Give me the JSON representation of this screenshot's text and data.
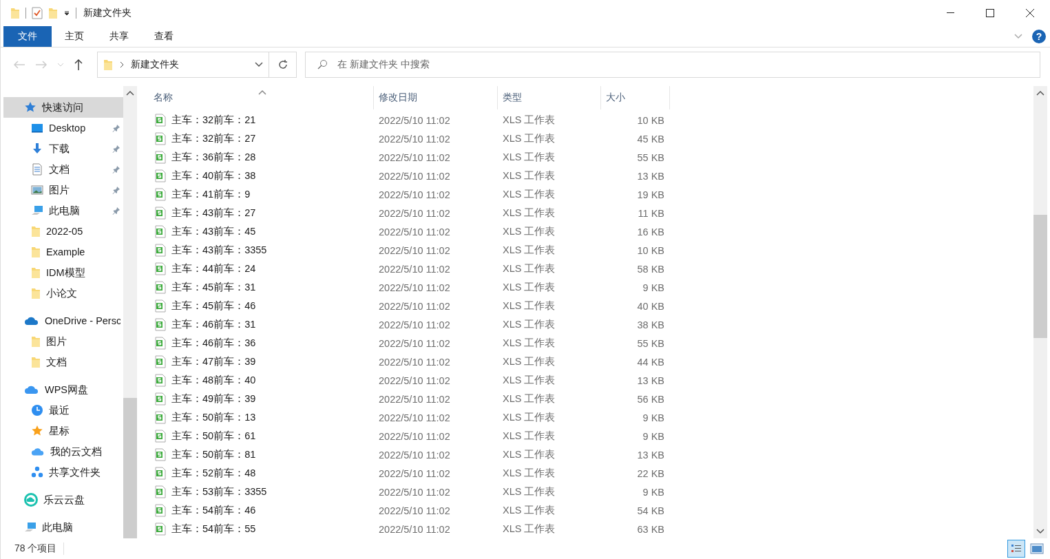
{
  "window": {
    "title": "新建文件夹"
  },
  "ribbon_tabs": [
    {
      "label": "文件",
      "selected": true
    },
    {
      "label": "主页",
      "selected": false
    },
    {
      "label": "共享",
      "selected": false
    },
    {
      "label": "查看",
      "selected": false
    }
  ],
  "help": "?",
  "address": {
    "path": "新建文件夹"
  },
  "search": {
    "placeholder": "在 新建文件夹 中搜索"
  },
  "sidebar": [
    {
      "label": "快速访问",
      "kind": "quick",
      "selected": true,
      "children": [
        {
          "label": "Desktop",
          "kind": "desktop",
          "pinned": true
        },
        {
          "label": "下载",
          "kind": "download",
          "pinned": true
        },
        {
          "label": "文档",
          "kind": "document",
          "pinned": true
        },
        {
          "label": "图片",
          "kind": "pictures",
          "pinned": true
        },
        {
          "label": "此电脑",
          "kind": "pc",
          "pinned": true
        },
        {
          "label": "2022-05",
          "kind": "folder",
          "pinned": false
        },
        {
          "label": "Example",
          "kind": "folder",
          "pinned": false
        },
        {
          "label": "IDM模型",
          "kind": "folder",
          "pinned": false
        },
        {
          "label": "小论文",
          "kind": "folder",
          "pinned": false
        }
      ]
    },
    {
      "label": "OneDrive - Persc",
      "kind": "onedrive",
      "selected": false,
      "children": [
        {
          "label": "图片",
          "kind": "folder",
          "pinned": false
        },
        {
          "label": "文档",
          "kind": "folder",
          "pinned": false
        }
      ]
    },
    {
      "label": "WPS网盘",
      "kind": "wps",
      "selected": false,
      "children": [
        {
          "label": "最近",
          "kind": "clock",
          "pinned": false
        },
        {
          "label": "星标",
          "kind": "star",
          "pinned": false
        },
        {
          "label": "我的云文档",
          "kind": "cloud",
          "pinned": false
        },
        {
          "label": "共享文件夹",
          "kind": "share",
          "pinned": false
        }
      ]
    },
    {
      "label": "乐云云盘",
      "kind": "leyun",
      "selected": false
    },
    {
      "label": "此电脑",
      "kind": "pc",
      "selected": false
    }
  ],
  "table": {
    "columns": [
      "名称",
      "修改日期",
      "类型",
      "大小"
    ],
    "rows": [
      [
        "主车：32前车：21",
        "2022/5/10 11:02",
        "XLS 工作表",
        "10 KB"
      ],
      [
        "主车：32前车：27",
        "2022/5/10 11:02",
        "XLS 工作表",
        "45 KB"
      ],
      [
        "主车：36前车：28",
        "2022/5/10 11:02",
        "XLS 工作表",
        "55 KB"
      ],
      [
        "主车：40前车：38",
        "2022/5/10 11:02",
        "XLS 工作表",
        "13 KB"
      ],
      [
        "主车：41前车：9",
        "2022/5/10 11:02",
        "XLS 工作表",
        "19 KB"
      ],
      [
        "主车：43前车：27",
        "2022/5/10 11:02",
        "XLS 工作表",
        "11 KB"
      ],
      [
        "主车：43前车：45",
        "2022/5/10 11:02",
        "XLS 工作表",
        "16 KB"
      ],
      [
        "主车：43前车：3355",
        "2022/5/10 11:02",
        "XLS 工作表",
        "10 KB"
      ],
      [
        "主车：44前车：24",
        "2022/5/10 11:02",
        "XLS 工作表",
        "58 KB"
      ],
      [
        "主车：45前车：31",
        "2022/5/10 11:02",
        "XLS 工作表",
        "9 KB"
      ],
      [
        "主车：45前车：46",
        "2022/5/10 11:02",
        "XLS 工作表",
        "40 KB"
      ],
      [
        "主车：46前车：31",
        "2022/5/10 11:02",
        "XLS 工作表",
        "38 KB"
      ],
      [
        "主车：46前车：36",
        "2022/5/10 11:02",
        "XLS 工作表",
        "55 KB"
      ],
      [
        "主车：47前车：39",
        "2022/5/10 11:02",
        "XLS 工作表",
        "44 KB"
      ],
      [
        "主车：48前车：40",
        "2022/5/10 11:02",
        "XLS 工作表",
        "13 KB"
      ],
      [
        "主车：49前车：39",
        "2022/5/10 11:02",
        "XLS 工作表",
        "56 KB"
      ],
      [
        "主车：50前车：13",
        "2022/5/10 11:02",
        "XLS 工作表",
        "9 KB"
      ],
      [
        "主车：50前车：61",
        "2022/5/10 11:02",
        "XLS 工作表",
        "9 KB"
      ],
      [
        "主车：50前车：81",
        "2022/5/10 11:02",
        "XLS 工作表",
        "13 KB"
      ],
      [
        "主车：52前车：48",
        "2022/5/10 11:02",
        "XLS 工作表",
        "22 KB"
      ],
      [
        "主车：53前车：3355",
        "2022/5/10 11:02",
        "XLS 工作表",
        "9 KB"
      ],
      [
        "主车：54前车：46",
        "2022/5/10 11:02",
        "XLS 工作表",
        "54 KB"
      ],
      [
        "主车：54前车：55",
        "2022/5/10 11:02",
        "XLS 工作表",
        "63 KB"
      ]
    ]
  },
  "status_bar": {
    "count": "78 个项目"
  },
  "view_buttons": [
    {
      "kind": "details",
      "selected": true
    },
    {
      "kind": "large-icons",
      "selected": false
    }
  ]
}
